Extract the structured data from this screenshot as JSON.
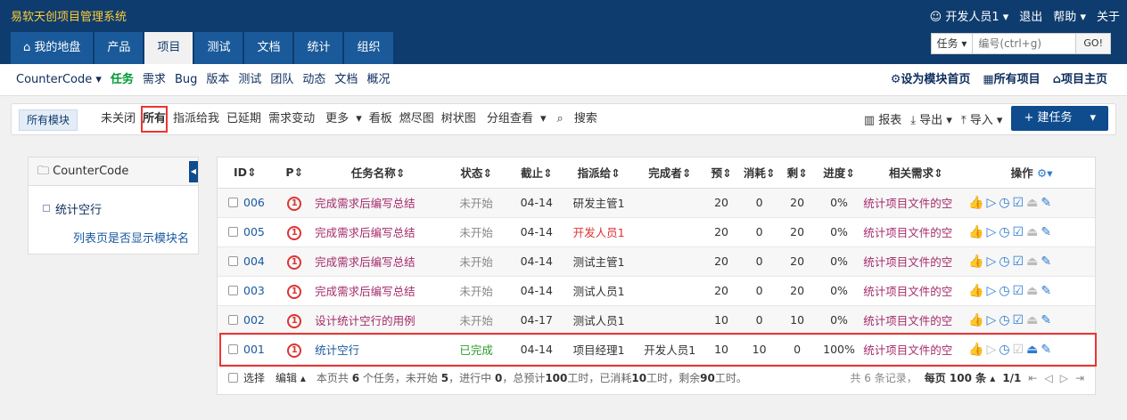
{
  "app_title": "易软天创项目管理系统",
  "user_menu": {
    "user": "开发人员1",
    "logout": "退出",
    "help": "帮助",
    "about": "关于"
  },
  "nav_tabs": [
    "我的地盘",
    "产品",
    "项目",
    "测试",
    "文档",
    "统计",
    "组织"
  ],
  "search": {
    "type": "任务",
    "placeholder": "编号(ctrl+g)",
    "go": "GO!"
  },
  "subnav": {
    "project": "CounterCode",
    "items": [
      "任务",
      "需求",
      "Bug",
      "版本",
      "测试",
      "团队",
      "动态",
      "文档",
      "概况"
    ],
    "right": [
      "设为模块首页",
      "所有项目",
      "项目主页"
    ]
  },
  "featurebar": {
    "module": "所有模块",
    "items": [
      "未关闭",
      "所有",
      "指派给我",
      "已延期",
      "需求变动",
      "更多",
      "看板",
      "燃尽图",
      "树状图",
      "分组查看",
      "搜索"
    ],
    "actions": [
      "报表",
      "导出",
      "导入"
    ],
    "create": "+ 建任务"
  },
  "sidebar": {
    "title": "CounterCode",
    "module": "统计空行",
    "link": "列表页是否显示模块名"
  },
  "table": {
    "headers": [
      "ID",
      "P",
      "任务名称",
      "状态",
      "截止",
      "指派给",
      "完成者",
      "预",
      "消耗",
      "剩",
      "进度",
      "相关需求",
      "操作"
    ],
    "rows": [
      {
        "id": "006",
        "p": "1",
        "name": "完成需求后编写总结",
        "status": "未开始",
        "deadline": "04-14",
        "assigned": "研发主管1",
        "finished": "",
        "est": "20",
        "consumed": "0",
        "left": "20",
        "progress": "0%",
        "story": "统计项目文件的空"
      },
      {
        "id": "005",
        "p": "1",
        "name": "完成需求后编写总结",
        "status": "未开始",
        "deadline": "04-14",
        "assigned": "开发人员1",
        "finished": "",
        "est": "20",
        "consumed": "0",
        "left": "20",
        "progress": "0%",
        "story": "统计项目文件的空"
      },
      {
        "id": "004",
        "p": "1",
        "name": "完成需求后编写总结",
        "status": "未开始",
        "deadline": "04-14",
        "assigned": "测试主管1",
        "finished": "",
        "est": "20",
        "consumed": "0",
        "left": "20",
        "progress": "0%",
        "story": "统计项目文件的空"
      },
      {
        "id": "003",
        "p": "1",
        "name": "完成需求后编写总结",
        "status": "未开始",
        "deadline": "04-14",
        "assigned": "测试人员1",
        "finished": "",
        "est": "20",
        "consumed": "0",
        "left": "20",
        "progress": "0%",
        "story": "统计项目文件的空"
      },
      {
        "id": "002",
        "p": "1",
        "name": "设计统计空行的用例",
        "status": "未开始",
        "deadline": "04-17",
        "assigned": "测试人员1",
        "finished": "",
        "est": "10",
        "consumed": "0",
        "left": "10",
        "progress": "0%",
        "story": "统计项目文件的空"
      },
      {
        "id": "001",
        "p": "1",
        "name": "统计空行",
        "status": "已完成",
        "deadline": "04-14",
        "assigned": "项目经理1",
        "finished": "开发人员1",
        "est": "10",
        "consumed": "10",
        "left": "0",
        "progress": "100%",
        "story": "统计项目文件的空"
      }
    ]
  },
  "footer": {
    "select": "选择",
    "edit": "编辑",
    "summary_pre": "本页共",
    "count": "6",
    "summary_mid1": "个任务，未开始",
    "notstart": "5",
    "summary_mid2": "，进行中",
    "ongoing": "0",
    "summary_mid3": "，总预计",
    "est": "100",
    "summary_mid4": "工时，已消耗",
    "used": "10",
    "summary_mid5": "工时，剩余",
    "left": "90",
    "summary_end": "工时。",
    "records": "共 6 条记录，",
    "perpage": "每页 100 条",
    "page": "1/1"
  }
}
